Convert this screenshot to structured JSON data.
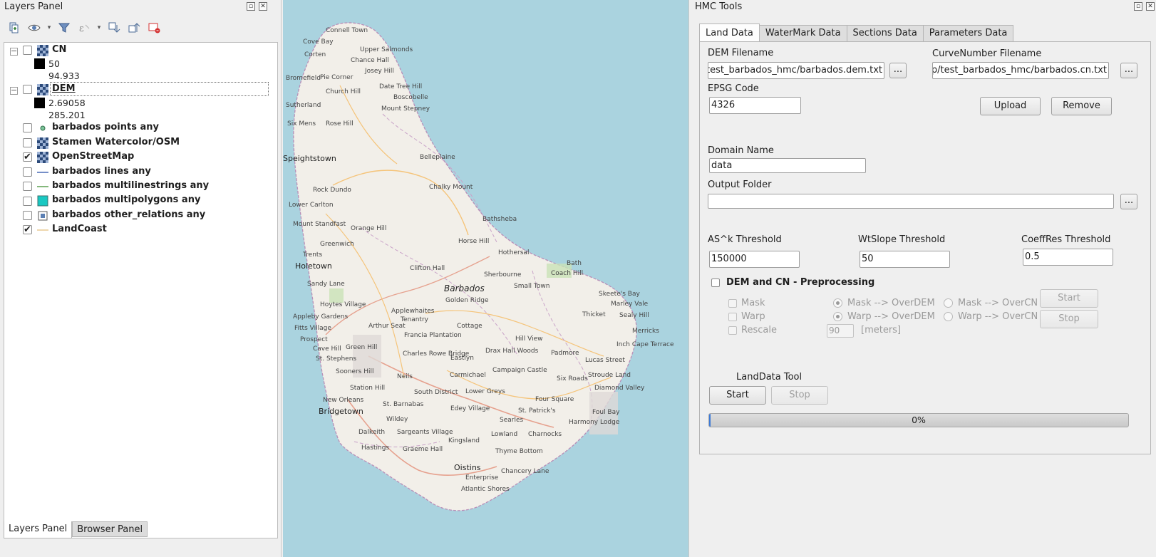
{
  "layers_panel": {
    "title": "Layers Panel",
    "layers": [
      {
        "name": "CN",
        "checked": false,
        "icon": "raster-grid-icon",
        "legend": [
          "50",
          "94.933"
        ]
      },
      {
        "name": "DEM",
        "checked": false,
        "icon": "raster-grid-icon",
        "legend": [
          "2.69058",
          "285.201"
        ]
      },
      {
        "name": "barbados points any",
        "checked": false,
        "icon": "point-symbol-icon"
      },
      {
        "name": "Stamen Watercolor/OSM",
        "checked": false,
        "icon": "raster-grid-icon"
      },
      {
        "name": "OpenStreetMap",
        "checked": true,
        "icon": "raster-grid-icon"
      },
      {
        "name": "barbados lines any",
        "checked": false,
        "icon": "line-symbol-icon"
      },
      {
        "name": "barbados multilinestrings any",
        "checked": false,
        "icon": "line-symbol-icon"
      },
      {
        "name": "barbados multipolygons any",
        "checked": false,
        "icon": "polygon-symbol-icon"
      },
      {
        "name": "barbados other_relations any",
        "checked": false,
        "icon": "mixed-geometry-icon"
      },
      {
        "name": "LandCoast",
        "checked": true,
        "icon": "line-symbol-icon"
      }
    ],
    "bottom_tabs": [
      "Layers Panel",
      "Browser Panel"
    ]
  },
  "map": {
    "places": [
      "Connell Town",
      "Cove Bay",
      "Upper Salmonds",
      "Chance Hall",
      "Corten",
      "Josey Hill",
      "Bromefield",
      "Church Hill",
      "Pie Corner",
      "Date Tree Hill",
      "Boscobelle",
      "Sutherland",
      "Mount Stepney",
      "Six Mens",
      "Rose Hill",
      "Speightstown",
      "Belleplaine",
      "Rock Dundo",
      "Chalky Mount",
      "Lower Carlton",
      "Bathsheba",
      "Mount Standfast",
      "Orange Hill",
      "Greenwich",
      "Horse Hill",
      "Hothersal",
      "Trents",
      "Holetown",
      "Clifton Hall",
      "Bath",
      "Coach Hill",
      "Sandy Lane",
      "Sherbourne",
      "Small Town",
      "Barbados",
      "Golden Ridge",
      "Skeete's Bay",
      "Marley Vale",
      "Hoytes Village",
      "Sealy Hill",
      "Appleby Gardens",
      "Applewhaites",
      "Tenantry",
      "Thicket",
      "Fitts Village",
      "Arthur Seat",
      "Cottage",
      "Merricks",
      "Prospect",
      "Francia Plantation",
      "Hill View",
      "Cave Hill",
      "Green Hill",
      "Drax Hall Woods",
      "Padmore",
      "Inch Cape Terrace",
      "St. Stephens",
      "Charles Rowe Bridge",
      "Eastlyn",
      "Lucas Street",
      "Sooners Hill",
      "Carmichael",
      "Campaign Castle",
      "Stroude Land",
      "Neils",
      "Station Hill",
      "South District",
      "Lower Greys",
      "Six Roads",
      "Diamond Valley",
      "New Orleans",
      "Four Square",
      "Bridgetown",
      "St. Barnabas",
      "Edey Village",
      "St. Patrick's",
      "Foul Bay",
      "Wildey",
      "Searles",
      "Harmony Lodge",
      "Dalkeith",
      "Sargeants Village",
      "Lowland",
      "Chancery Lane",
      "Hastings",
      "Graeme Hall",
      "Kingsland",
      "Thyme Bottom",
      "Charnocks",
      "Oistins",
      "Enterprise",
      "Atlantic Shores"
    ]
  },
  "hmc": {
    "title": "HMC Tools",
    "tabs": [
      "Land Data",
      "WaterMark Data",
      "Sections Data",
      "Parameters Data"
    ],
    "dem_filename_label": "DEM Filename",
    "dem_filename_value": "C:/Users/HMC/Desktop/test_barbados_hmc/barbados.dem.txt",
    "curve_filename_label": "CurveNumber Filename",
    "curve_filename_value": "C:/Users/HMC/Desktop/test_barbados_hmc/barbados.cn.txt",
    "browse_label": "...",
    "epsg_label": "EPSG Code",
    "epsg_value": "4326",
    "upload_label": "Upload",
    "remove_label": "Remove",
    "domain_label": "Domain Name",
    "domain_value": "data",
    "output_label": "Output Folder",
    "output_value": "",
    "as_label": "AS^k Threshold",
    "as_value": "150000",
    "wt_label": "WtSlope Threshold",
    "wt_value": "50",
    "coeff_label": "CoeffRes Threshold",
    "coeff_value": "0.5",
    "preproc_label": "DEM and CN - Preprocessing",
    "mask_label": "Mask",
    "warp_label": "Warp",
    "rescale_label": "Rescale",
    "mask_overdem": "Mask --> OverDEM",
    "mask_overcn": "Mask --> OverCN",
    "warp_overdem": "Warp --> OverDEM",
    "warp_overcn": "Warp --> OverCN",
    "rescale_value": "90",
    "meters_label": "[meters]",
    "start_label": "Start",
    "stop_label": "Stop",
    "landdata_tool_label": "LandData Tool",
    "progress_value": 0,
    "progress_text": "0%"
  }
}
